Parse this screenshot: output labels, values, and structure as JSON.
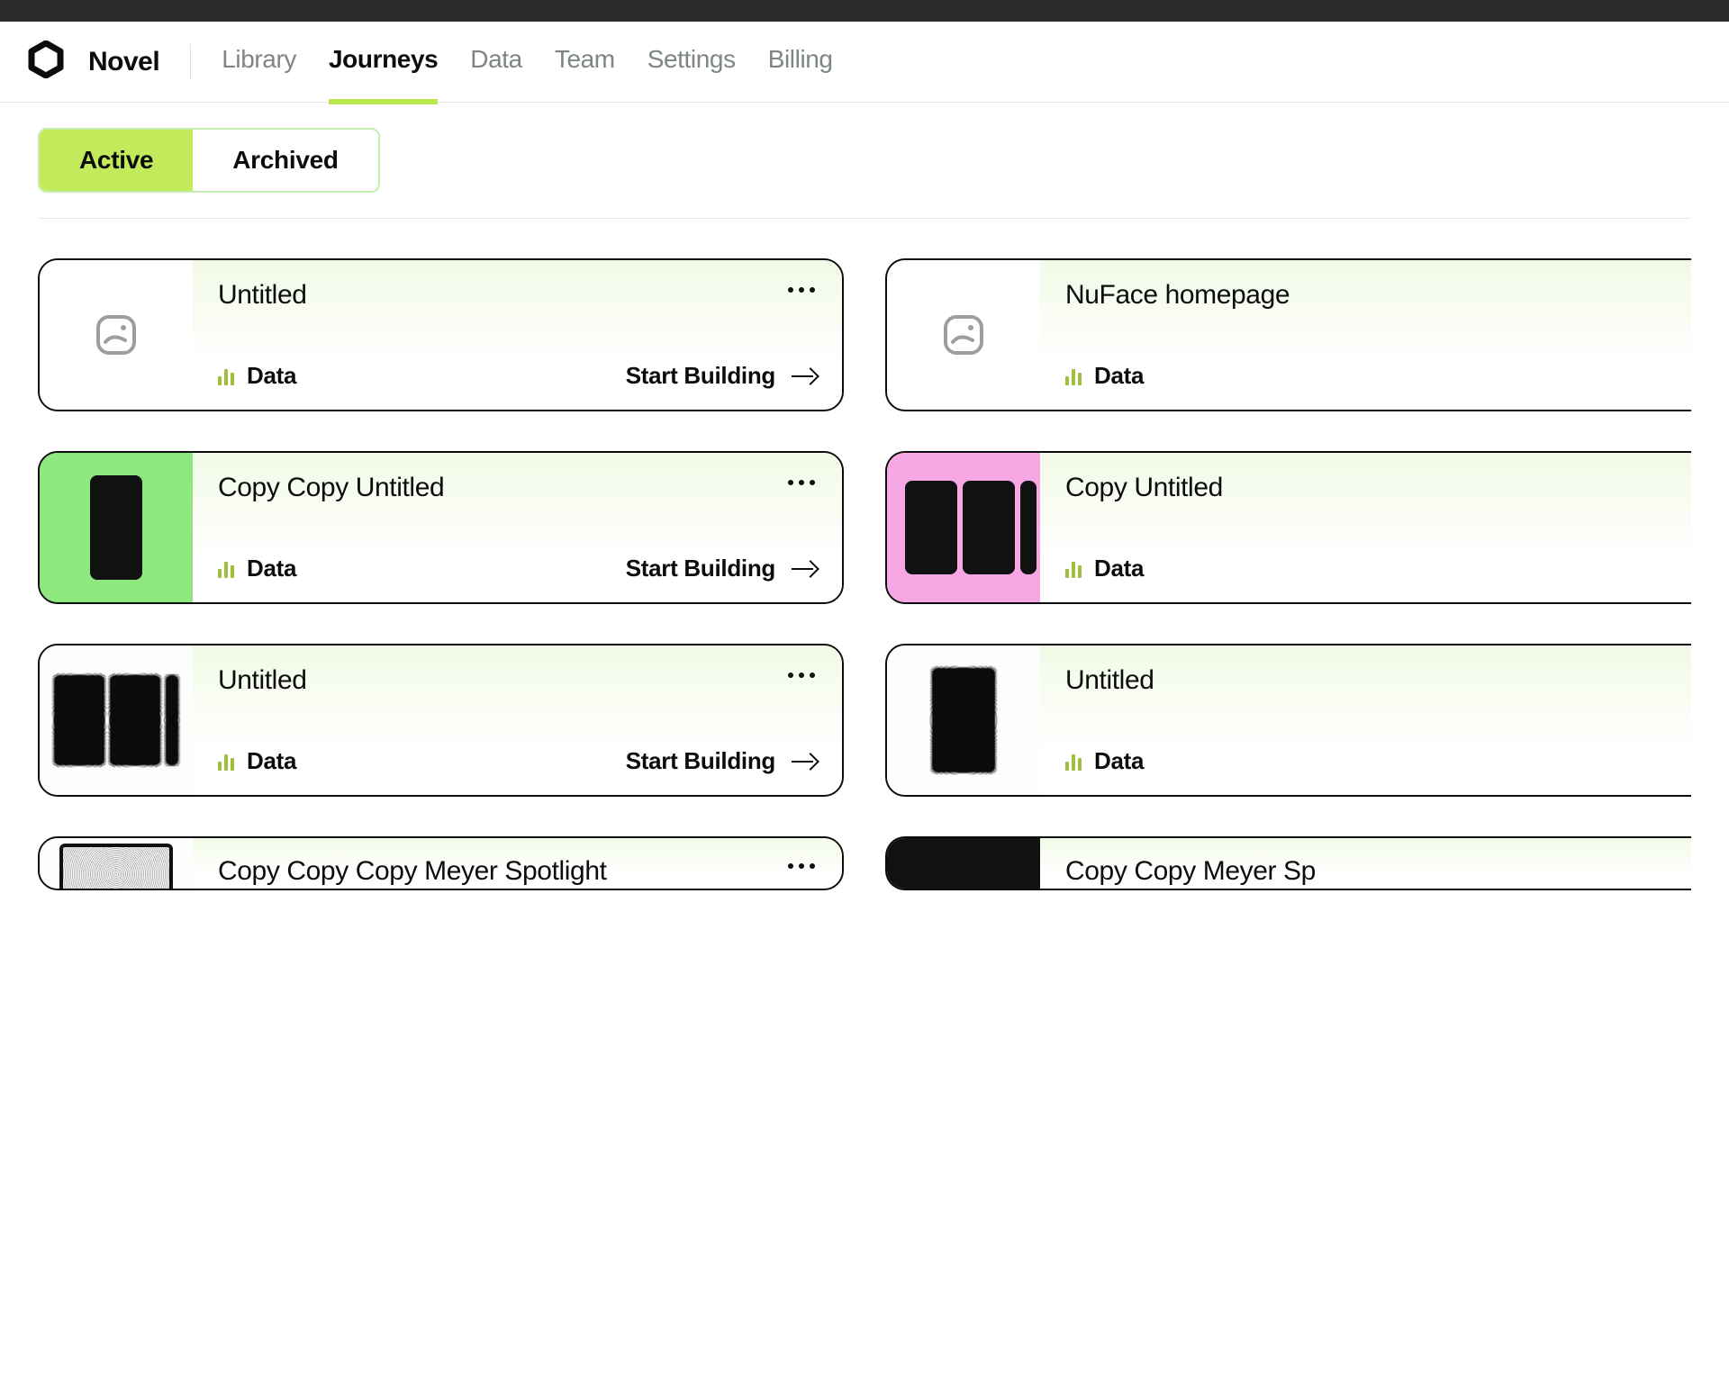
{
  "brand": "Novel",
  "nav": {
    "library": "Library",
    "journeys": "Journeys",
    "data": "Data",
    "team": "Team",
    "settings": "Settings",
    "billing": "Billing"
  },
  "tabs": {
    "active": "Active",
    "archived": "Archived"
  },
  "card_labels": {
    "data": "Data",
    "start": "Start Building"
  },
  "cards": [
    {
      "title": "Untitled"
    },
    {
      "title": "NuFace homepage"
    },
    {
      "title": "Copy Copy Untitled"
    },
    {
      "title": "Copy Untitled"
    },
    {
      "title": "Untitled"
    },
    {
      "title": "Untitled"
    },
    {
      "title": "Copy Copy Copy Meyer Spotlight"
    },
    {
      "title": "Copy Copy Meyer Sp"
    }
  ]
}
